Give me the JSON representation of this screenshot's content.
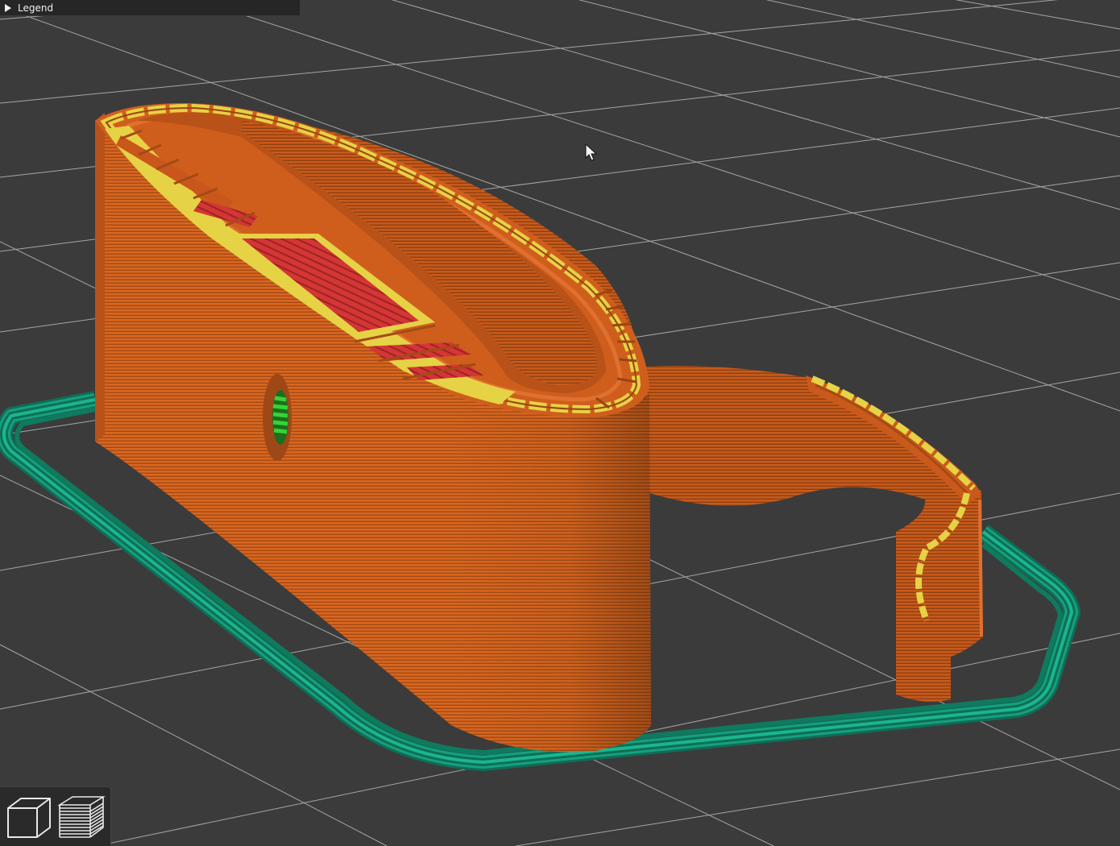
{
  "legend": {
    "label": "Legend",
    "collapsed": true
  },
  "toolbar": {
    "items": [
      {
        "name": "3d-view",
        "icon": "cube-icon"
      },
      {
        "name": "layers-view",
        "icon": "layers-icon"
      }
    ]
  },
  "colors": {
    "background": "#3b3b3b",
    "grid": "#b8b8b8",
    "perimeter": "#e06a22",
    "perimeter_dark": "#9e4818",
    "external_perimeter": "#e6d245",
    "solid_infill": "#cf3131",
    "skirt": "#12876a",
    "gap_fill": "#22c422"
  }
}
